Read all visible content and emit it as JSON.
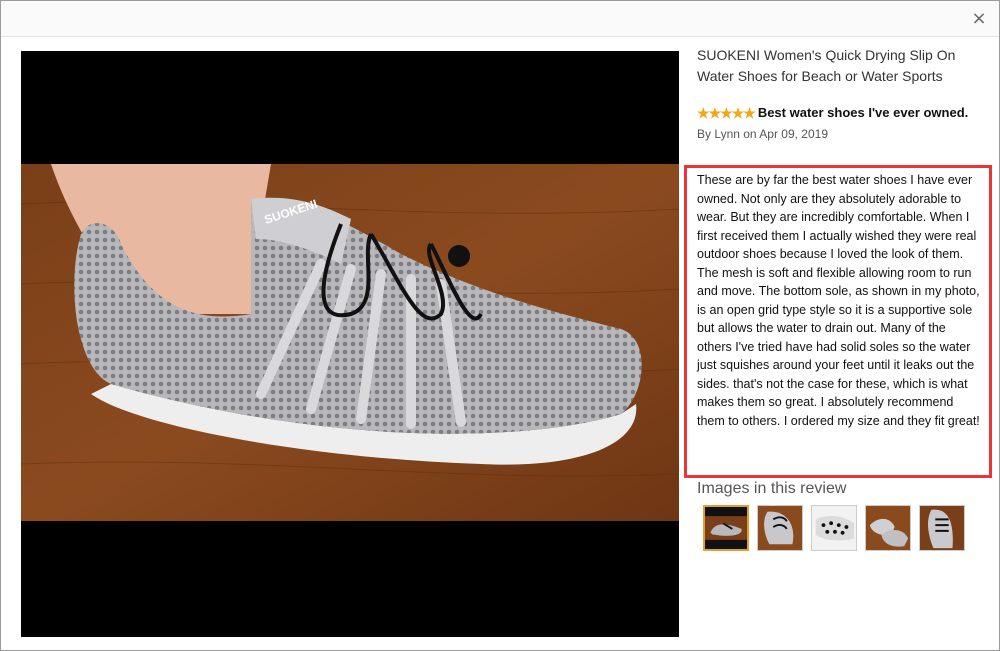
{
  "header": {
    "close_icon": "close-icon",
    "close_glyph": "×"
  },
  "product": {
    "title": "SUOKENI Women's Quick Drying Slip On Water Shoes for Beach or Water Sports"
  },
  "review": {
    "rating": 5,
    "stars_icon": "star-icon",
    "star_glyph": "★",
    "headline": "Best water shoes I've ever owned.",
    "byline": "By Lynn on Apr 09, 2019",
    "paragraphs": [
      "These are by far the best water shoes I have ever owned. Not only are they absolutely adorable to wear. But they are incredibly comfortable. When I first received them I actually wished they were real outdoor shoes because I loved the look of them.",
      "The mesh is soft and flexible allowing room to run and move. The bottom sole, as shown in my photo, is an open grid type style so it is a supportive sole but allows the water to drain out. Many of the others I've tried have had solid soles so the water just squishes around your feet until it leaks out the sides. that's not the case for these, which is what makes them so great. I absolutely recommend them to others. I ordered my size and they fit great!"
    ],
    "highlight_color": "#e8343b"
  },
  "gallery": {
    "heading": "Images in this review",
    "selected_index": 0,
    "thumbnails": [
      {
        "name": "thumbnail-shoe-side-view"
      },
      {
        "name": "thumbnail-shoe-laces-top"
      },
      {
        "name": "thumbnail-shoe-sole"
      },
      {
        "name": "thumbnail-shoe-pair"
      },
      {
        "name": "thumbnail-shoe-front"
      }
    ]
  }
}
